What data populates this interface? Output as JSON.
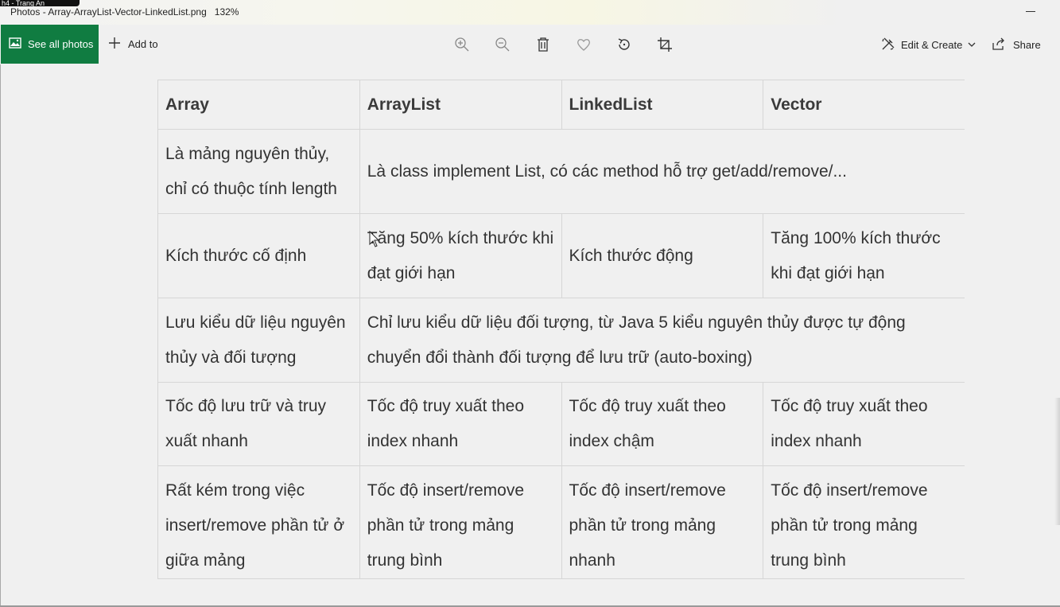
{
  "window": {
    "badge": "h4 - Trang An",
    "title": "Photos - Array-ArrayList-Vector-LinkedList.png",
    "zoom": "132%"
  },
  "toolbar": {
    "see_all_label": "See all photos",
    "add_to_label": "Add to",
    "icons": [
      "zoom-in-icon",
      "zoom-out-icon",
      "delete-icon",
      "favorite-icon",
      "rotate-icon",
      "crop-icon"
    ],
    "edit_create_label": "Edit & Create",
    "share_label": "Share"
  },
  "table": {
    "headers": [
      "Array",
      "ArrayList",
      "LinkedList",
      "Vector"
    ],
    "row1": {
      "c1": "Là mảng nguyên thủy, chỉ có thuộc tính length",
      "merged": "Là class implement List, có các method hỗ trợ get/add/remove/..."
    },
    "row2": [
      "Kích thước cố định",
      "Tăng 50% kích thước khi đạt giới hạn",
      "Kích thước động",
      "Tăng 100% kích thước khi đạt giới hạn"
    ],
    "row3": {
      "c1": "Lưu kiểu dữ liệu nguyên thủy và đối tượng",
      "merged": "Chỉ lưu kiểu dữ liệu đối tượng, từ Java 5 kiểu nguyên thủy được tự động chuyển đổi thành đối tượng để lưu trữ (auto-boxing)"
    },
    "row4": [
      "Tốc độ lưu trữ và truy xuất nhanh",
      "Tốc độ truy xuất theo index nhanh",
      "Tốc độ truy xuất theo index chậm",
      "Tốc độ truy xuất theo index nhanh"
    ],
    "row5": [
      "Rất kém trong việc insert/remove phần tử ở giữa mảng",
      "Tốc độ insert/remove phần tử trong mảng trung bình",
      "Tốc độ insert/remove phần tử trong mảng nhanh",
      "Tốc độ insert/remove phần tử trong mảng trung bình"
    ]
  },
  "colors": {
    "accent": "#107c41",
    "table_border": "#d6d6d6"
  }
}
